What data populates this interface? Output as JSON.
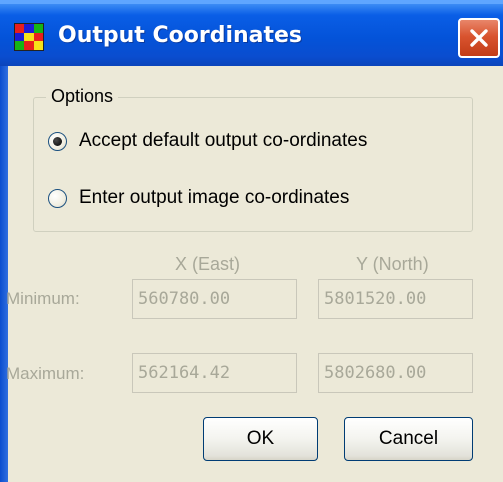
{
  "window": {
    "title": "Output Coordinates",
    "close_label": "close"
  },
  "options": {
    "legend": "Options",
    "radios": [
      {
        "label": "Accept default output co-ordinates",
        "checked": true
      },
      {
        "label": "Enter output image co-ordinates",
        "checked": false
      }
    ]
  },
  "coords": {
    "x_header": "X (East)",
    "y_header": "Y (North)",
    "min_label": "Minimum:",
    "max_label": "Maximum:",
    "min_x": "560780.00",
    "min_y": "5801520.00",
    "max_x": "562164.42",
    "max_y": "5802680.00"
  },
  "buttons": {
    "ok": "OK",
    "cancel": "Cancel"
  },
  "colors": {
    "titlebar": "#0453d9",
    "dialog_bg": "#ece9d8",
    "disabled_text": "#a8a899",
    "close_red": "#d9542f"
  },
  "icons": {
    "app": "app-grid-icon",
    "close": "close-icon",
    "radio_checked": "radio-checked",
    "radio_unchecked": "radio-unchecked"
  }
}
